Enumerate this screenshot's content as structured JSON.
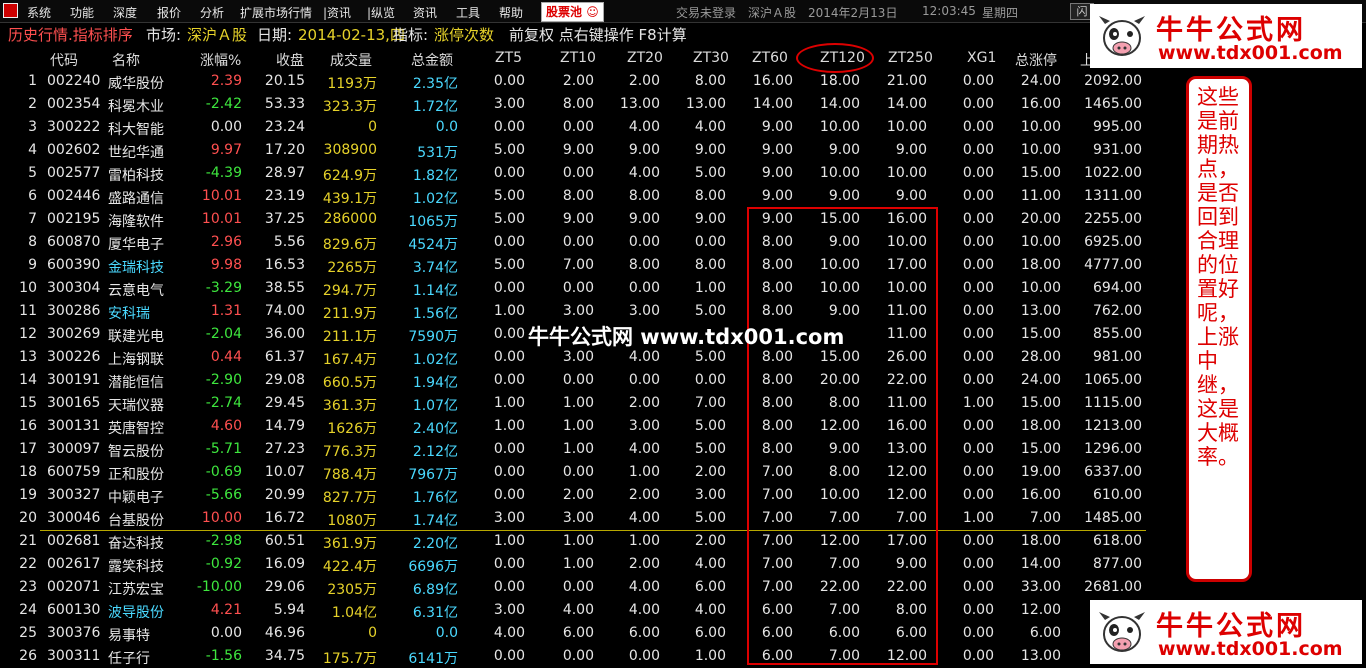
{
  "menu": {
    "items": [
      "系统",
      "功能",
      "深度",
      "报价",
      "分析",
      "扩展市场行情",
      "|资讯",
      "|纵览",
      "资讯",
      "工具",
      "帮助"
    ],
    "stock_pool": "股票池",
    "status": [
      "交易未登录",
      "深沪Ａ股",
      "2014年2月13日",
      "12:03:45",
      "星期四"
    ],
    "window_button": "闪"
  },
  "infobar": {
    "mode": "历史行情.指标排序",
    "market_label": "市场:",
    "market": "深沪Ａ股",
    "date_label": "日期:",
    "date": "2014-02-13,四",
    "indicator_label": "指标:",
    "indicator": "涨停次数",
    "ops": "前复权 点右键操作 F8计算"
  },
  "columns": [
    "代码",
    "名称",
    "涨幅%",
    "收盘",
    "成交量",
    "总金额",
    "ZT5",
    "ZT10",
    "ZT20",
    "ZT30",
    "ZT60",
    "ZT120",
    "ZT250",
    "XG1",
    "总涨停",
    "上"
  ],
  "rows": [
    {
      "n": "1",
      "code": "002240",
      "name": "威华股份",
      "chg": "2.39",
      "close": "20.15",
      "vol": "1193",
      "vu": "万",
      "amt": "2.35",
      "au": "亿",
      "zt": [
        "0.00",
        "2.00",
        "2.00",
        "8.00",
        "16.00",
        "18.00",
        "21.00",
        "0.00",
        "24.00",
        "2092.00"
      ],
      "nc": 0
    },
    {
      "n": "2",
      "code": "002354",
      "name": "科冕木业",
      "chg": "-2.42",
      "close": "53.33",
      "vol": "323.3",
      "vu": "万",
      "amt": "1.72",
      "au": "亿",
      "zt": [
        "3.00",
        "8.00",
        "13.00",
        "13.00",
        "14.00",
        "14.00",
        "14.00",
        "0.00",
        "16.00",
        "1465.00"
      ],
      "nc": 0
    },
    {
      "n": "3",
      "code": "300222",
      "name": "科大智能",
      "chg": "0.00",
      "close": "23.24",
      "vol": "0",
      "vu": "",
      "amt": "0.0",
      "au": "",
      "zt": [
        "0.00",
        "0.00",
        "4.00",
        "4.00",
        "9.00",
        "10.00",
        "10.00",
        "0.00",
        "10.00",
        "995.00"
      ],
      "nc": 0
    },
    {
      "n": "4",
      "code": "002602",
      "name": "世纪华通",
      "chg": "9.97",
      "close": "17.20",
      "vol": "308900",
      "vu": "",
      "amt": "531",
      "au": "万",
      "zt": [
        "5.00",
        "9.00",
        "9.00",
        "9.00",
        "9.00",
        "9.00",
        "9.00",
        "0.00",
        "10.00",
        "931.00"
      ],
      "nc": 0
    },
    {
      "n": "5",
      "code": "002577",
      "name": "雷柏科技",
      "chg": "-4.39",
      "close": "28.97",
      "vol": "624.9",
      "vu": "万",
      "amt": "1.82",
      "au": "亿",
      "zt": [
        "0.00",
        "0.00",
        "4.00",
        "5.00",
        "9.00",
        "10.00",
        "10.00",
        "0.00",
        "15.00",
        "1022.00"
      ],
      "nc": 0
    },
    {
      "n": "6",
      "code": "002446",
      "name": "盛路通信",
      "chg": "10.01",
      "close": "23.19",
      "vol": "439.1",
      "vu": "万",
      "amt": "1.02",
      "au": "亿",
      "zt": [
        "5.00",
        "8.00",
        "8.00",
        "8.00",
        "9.00",
        "9.00",
        "9.00",
        "0.00",
        "11.00",
        "1311.00"
      ],
      "nc": 0
    },
    {
      "n": "7",
      "code": "002195",
      "name": "海隆软件",
      "chg": "10.01",
      "close": "37.25",
      "vol": "286000",
      "vu": "",
      "amt": "1065",
      "au": "万",
      "zt": [
        "5.00",
        "9.00",
        "9.00",
        "9.00",
        "9.00",
        "15.00",
        "16.00",
        "0.00",
        "20.00",
        "2255.00"
      ],
      "nc": 0
    },
    {
      "n": "8",
      "code": "600870",
      "name": "厦华电子",
      "chg": "2.96",
      "close": "5.56",
      "vol": "829.6",
      "vu": "万",
      "amt": "4524",
      "au": "万",
      "zt": [
        "0.00",
        "0.00",
        "0.00",
        "0.00",
        "8.00",
        "9.00",
        "10.00",
        "0.00",
        "10.00",
        "6925.00"
      ],
      "nc": 0
    },
    {
      "n": "9",
      "code": "600390",
      "name": "金瑞科技",
      "chg": "9.98",
      "close": "16.53",
      "vol": "2265",
      "vu": "万",
      "amt": "3.74",
      "au": "亿",
      "zt": [
        "5.00",
        "7.00",
        "8.00",
        "8.00",
        "8.00",
        "10.00",
        "17.00",
        "0.00",
        "18.00",
        "4777.00"
      ],
      "nc": 1
    },
    {
      "n": "10",
      "code": "300304",
      "name": "云意电气",
      "chg": "-3.29",
      "close": "38.55",
      "vol": "294.7",
      "vu": "万",
      "amt": "1.14",
      "au": "亿",
      "zt": [
        "0.00",
        "0.00",
        "0.00",
        "1.00",
        "8.00",
        "10.00",
        "10.00",
        "0.00",
        "10.00",
        "694.00"
      ],
      "nc": 0
    },
    {
      "n": "11",
      "code": "300286",
      "name": "安科瑞",
      "chg": "1.31",
      "close": "74.00",
      "vol": "211.9",
      "vu": "万",
      "amt": "1.56",
      "au": "亿",
      "zt": [
        "1.00",
        "3.00",
        "3.00",
        "5.00",
        "8.00",
        "9.00",
        "11.00",
        "0.00",
        "13.00",
        "762.00"
      ],
      "nc": 1
    },
    {
      "n": "12",
      "code": "300269",
      "name": "联建光电",
      "chg": "-2.04",
      "close": "36.00",
      "vol": "211.1",
      "vu": "万",
      "amt": "7590",
      "au": "万",
      "zt": [
        "0.00",
        "",
        "",
        "",
        "",
        "",
        "11.00",
        "0.00",
        "15.00",
        "855.00"
      ],
      "nc": 0
    },
    {
      "n": "13",
      "code": "300226",
      "name": "上海钢联",
      "chg": "0.44",
      "close": "61.37",
      "vol": "167.4",
      "vu": "万",
      "amt": "1.02",
      "au": "亿",
      "zt": [
        "0.00",
        "3.00",
        "4.00",
        "5.00",
        "8.00",
        "15.00",
        "26.00",
        "0.00",
        "28.00",
        "981.00"
      ],
      "nc": 0
    },
    {
      "n": "14",
      "code": "300191",
      "name": "潜能恒信",
      "chg": "-2.90",
      "close": "29.08",
      "vol": "660.5",
      "vu": "万",
      "amt": "1.94",
      "au": "亿",
      "zt": [
        "0.00",
        "0.00",
        "0.00",
        "0.00",
        "8.00",
        "20.00",
        "22.00",
        "0.00",
        "24.00",
        "1065.00"
      ],
      "nc": 0
    },
    {
      "n": "15",
      "code": "300165",
      "name": "天瑞仪器",
      "chg": "-2.74",
      "close": "29.45",
      "vol": "361.3",
      "vu": "万",
      "amt": "1.07",
      "au": "亿",
      "zt": [
        "1.00",
        "1.00",
        "2.00",
        "7.00",
        "8.00",
        "8.00",
        "11.00",
        "1.00",
        "15.00",
        "1115.00"
      ],
      "nc": 0
    },
    {
      "n": "16",
      "code": "300131",
      "name": "英唐智控",
      "chg": "4.60",
      "close": "14.79",
      "vol": "1626",
      "vu": "万",
      "amt": "2.40",
      "au": "亿",
      "zt": [
        "1.00",
        "1.00",
        "3.00",
        "5.00",
        "8.00",
        "12.00",
        "16.00",
        "0.00",
        "18.00",
        "1213.00"
      ],
      "nc": 0
    },
    {
      "n": "17",
      "code": "300097",
      "name": "智云股份",
      "chg": "-5.71",
      "close": "27.23",
      "vol": "776.3",
      "vu": "万",
      "amt": "2.12",
      "au": "亿",
      "zt": [
        "0.00",
        "1.00",
        "4.00",
        "5.00",
        "8.00",
        "9.00",
        "13.00",
        "0.00",
        "15.00",
        "1296.00"
      ],
      "nc": 0
    },
    {
      "n": "18",
      "code": "600759",
      "name": "正和股份",
      "chg": "-0.69",
      "close": "10.07",
      "vol": "788.4",
      "vu": "万",
      "amt": "7967",
      "au": "万",
      "zt": [
        "0.00",
        "0.00",
        "1.00",
        "2.00",
        "7.00",
        "8.00",
        "12.00",
        "0.00",
        "19.00",
        "6337.00"
      ],
      "nc": 0
    },
    {
      "n": "19",
      "code": "300327",
      "name": "中颖电子",
      "chg": "-5.66",
      "close": "20.99",
      "vol": "827.7",
      "vu": "万",
      "amt": "1.76",
      "au": "亿",
      "zt": [
        "0.00",
        "2.00",
        "2.00",
        "3.00",
        "7.00",
        "10.00",
        "12.00",
        "0.00",
        "16.00",
        "610.00"
      ],
      "nc": 0
    },
    {
      "n": "20",
      "code": "300046",
      "name": "台基股份",
      "chg": "10.00",
      "close": "16.72",
      "vol": "1080",
      "vu": "万",
      "amt": "1.74",
      "au": "亿",
      "zt": [
        "3.00",
        "3.00",
        "4.00",
        "5.00",
        "7.00",
        "7.00",
        "7.00",
        "1.00",
        "7.00",
        "1485.00"
      ],
      "nc": 0
    },
    {
      "n": "21",
      "code": "002681",
      "name": "奋达科技",
      "chg": "-2.98",
      "close": "60.51",
      "vol": "361.9",
      "vu": "万",
      "amt": "2.20",
      "au": "亿",
      "zt": [
        "1.00",
        "1.00",
        "1.00",
        "2.00",
        "7.00",
        "12.00",
        "17.00",
        "0.00",
        "18.00",
        "618.00"
      ],
      "nc": 0
    },
    {
      "n": "22",
      "code": "002617",
      "name": "露笑科技",
      "chg": "-0.92",
      "close": "16.09",
      "vol": "422.4",
      "vu": "万",
      "amt": "6696",
      "au": "万",
      "zt": [
        "0.00",
        "1.00",
        "2.00",
        "4.00",
        "7.00",
        "7.00",
        "9.00",
        "0.00",
        "14.00",
        "877.00"
      ],
      "nc": 0
    },
    {
      "n": "23",
      "code": "002071",
      "name": "江苏宏宝",
      "chg": "-10.00",
      "close": "29.06",
      "vol": "2305",
      "vu": "万",
      "amt": "6.89",
      "au": "亿",
      "zt": [
        "0.00",
        "0.00",
        "4.00",
        "6.00",
        "7.00",
        "22.00",
        "22.00",
        "0.00",
        "33.00",
        "2681.00"
      ],
      "nc": 0
    },
    {
      "n": "24",
      "code": "600130",
      "name": "波导股份",
      "chg": "4.21",
      "close": "5.94",
      "vol": "1.04",
      "vu": "亿",
      "amt": "6.31",
      "au": "亿",
      "zt": [
        "3.00",
        "4.00",
        "4.00",
        "4.00",
        "6.00",
        "7.00",
        "8.00",
        "0.00",
        "12.00",
        ""
      ],
      "nc": 1
    },
    {
      "n": "25",
      "code": "300376",
      "name": "易事特",
      "chg": "0.00",
      "close": "46.96",
      "vol": "0",
      "vu": "",
      "amt": "0.0",
      "au": "",
      "zt": [
        "4.00",
        "6.00",
        "6.00",
        "6.00",
        "6.00",
        "6.00",
        "6.00",
        "0.00",
        "6.00",
        ""
      ],
      "nc": 0
    },
    {
      "n": "26",
      "code": "300311",
      "name": "任子行",
      "chg": "-1.56",
      "close": "34.75",
      "vol": "175.7",
      "vu": "万",
      "amt": "6141",
      "au": "万",
      "zt": [
        "0.00",
        "0.00",
        "0.00",
        "1.00",
        "6.00",
        "7.00",
        "12.00",
        "0.00",
        "13.00",
        ""
      ],
      "nc": 0
    }
  ],
  "watermark": "牛牛公式网 www.tdx001.com",
  "note": "这些是前期热点，是否回到合理的位置好呢，上涨中继，这是大概率。",
  "brand": {
    "name": "牛牛公式网",
    "url": "www.tdx001.com"
  },
  "colors": {
    "up": "#ff5050",
    "down": "#3ee63e",
    "flat": "#e6e6e6",
    "amount": "#4ad9ff",
    "volume": "#e6d22a",
    "annotation": "#dd0000"
  }
}
